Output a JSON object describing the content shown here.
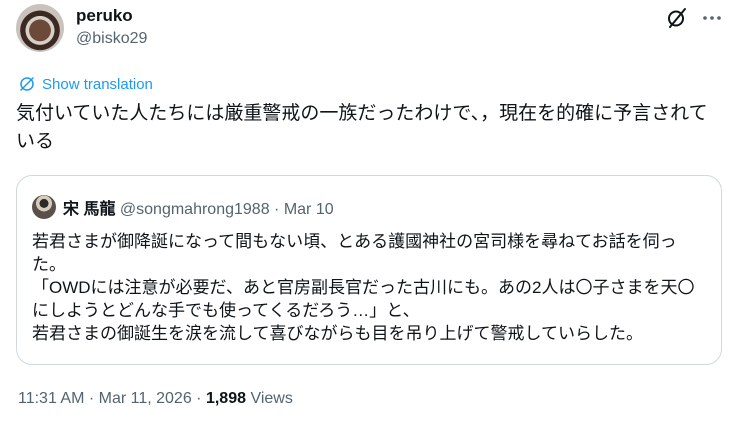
{
  "tweet": {
    "author": {
      "name": "peruko",
      "handle": "@bisko29"
    },
    "show_translation": "Show translation",
    "text": "気付いていた人たちには厳重警戒の一族だったわけで、，現在を的確に予言されている",
    "timestamp": "11:31 AM · Mar 11, 2026",
    "separator": " · ",
    "views": {
      "count": "1,898",
      "label": "Views"
    }
  },
  "quote": {
    "author": {
      "name": "宋 馬龍",
      "handle": "@songmahrong1988",
      "date": "Mar 10"
    },
    "meta_separator": " · ",
    "lines": [
      "若君さまが御降誕になって間もない頃、とある護國神社の宮司様を尋ねてお話を伺った。",
      "「OWDには注意が必要だ、あと官房副長官だった古川にも。あの2人は〇子さまを天〇にしようとどんな手でも使ってくるだろう…」と、",
      "若君さまの御誕生を涙を流して喜びながらも目を吊り上げて警戒していらした。"
    ]
  },
  "icons": {
    "grok": "grok-icon",
    "more": "more-icon",
    "translate": "translate-icon"
  },
  "colors": {
    "accent": "#1d9bf0",
    "text": "#0f1419",
    "muted": "#536471",
    "border": "#cfd9de"
  }
}
